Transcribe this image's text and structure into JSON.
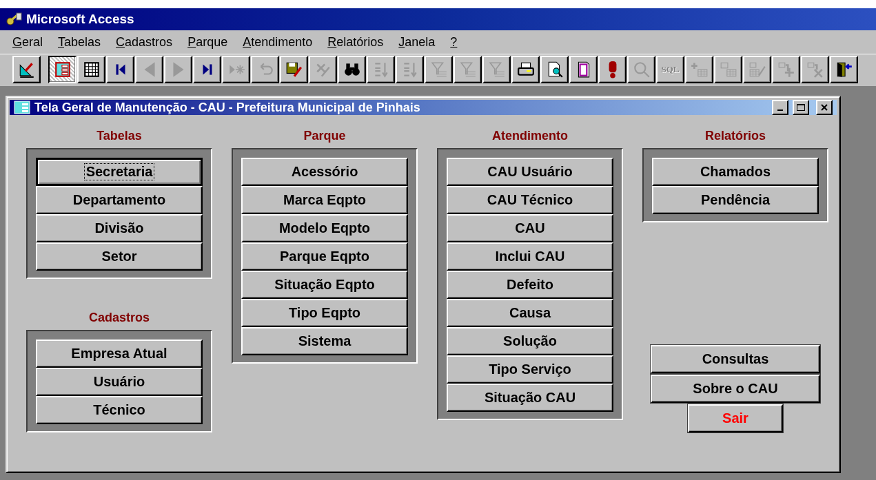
{
  "window": {
    "title": "Microsoft Access"
  },
  "menu": [
    "Geral",
    "Tabelas",
    "Cadastros",
    "Parque",
    "Atendimento",
    "Relatórios",
    "Janela",
    "?"
  ],
  "toolbar": [
    {
      "kind": "design",
      "disabled": false,
      "pressed": false
    },
    {
      "kind": "form",
      "disabled": false,
      "pressed": true
    },
    {
      "kind": "datasheet",
      "disabled": false,
      "pressed": false
    },
    {
      "kind": "first",
      "disabled": false,
      "pressed": false
    },
    {
      "kind": "prev",
      "disabled": true,
      "pressed": false
    },
    {
      "kind": "next",
      "disabled": true,
      "pressed": false
    },
    {
      "kind": "last",
      "disabled": false,
      "pressed": false
    },
    {
      "kind": "new-record",
      "disabled": true,
      "pressed": false
    },
    {
      "kind": "undo",
      "disabled": true,
      "pressed": false
    },
    {
      "kind": "save",
      "disabled": false,
      "pressed": false
    },
    {
      "kind": "delete",
      "disabled": true,
      "pressed": false
    },
    {
      "kind": "find",
      "disabled": false,
      "pressed": false
    },
    {
      "kind": "sort-asc",
      "disabled": true,
      "pressed": false
    },
    {
      "kind": "sort-desc",
      "disabled": true,
      "pressed": false
    },
    {
      "kind": "filter",
      "disabled": true,
      "pressed": false
    },
    {
      "kind": "filter",
      "disabled": true,
      "pressed": false
    },
    {
      "kind": "filter",
      "disabled": true,
      "pressed": false
    },
    {
      "kind": "print",
      "disabled": false,
      "pressed": false
    },
    {
      "kind": "preview",
      "disabled": false,
      "pressed": false
    },
    {
      "kind": "page",
      "disabled": false,
      "pressed": false
    },
    {
      "kind": "run",
      "disabled": false,
      "pressed": false
    },
    {
      "kind": "zoom",
      "disabled": true,
      "pressed": false
    },
    {
      "kind": "sql",
      "label": "SQL",
      "disabled": true,
      "pressed": false
    },
    {
      "kind": "table-add",
      "disabled": true,
      "pressed": false
    },
    {
      "kind": "table-show",
      "disabled": true,
      "pressed": false
    },
    {
      "kind": "table-edit",
      "disabled": true,
      "pressed": false
    },
    {
      "kind": "relation-add",
      "disabled": true,
      "pressed": false
    },
    {
      "kind": "relation-remove",
      "disabled": true,
      "pressed": false
    },
    {
      "kind": "exit",
      "disabled": false,
      "pressed": false
    }
  ],
  "form": {
    "title": "Tela Geral de Manutenção - CAU - Prefeitura Municipal de Pinhais",
    "columns": [
      {
        "groups": [
          {
            "heading": "Tabelas",
            "buttons": [
              {
                "label": "Secretaria",
                "focused": true
              },
              {
                "label": "Departamento",
                "focused": false
              },
              {
                "label": "Divisão",
                "focused": false
              },
              {
                "label": "Setor",
                "focused": false
              }
            ]
          },
          {
            "heading": "Cadastros",
            "buttons": [
              {
                "label": "Empresa Atual",
                "focused": false
              },
              {
                "label": "Usuário",
                "focused": false
              },
              {
                "label": "Técnico",
                "focused": false
              }
            ]
          }
        ]
      },
      {
        "groups": [
          {
            "heading": "Parque",
            "buttons": [
              {
                "label": "Acessório",
                "focused": false
              },
              {
                "label": "Marca Eqpto",
                "focused": false
              },
              {
                "label": "Modelo Eqpto",
                "focused": false
              },
              {
                "label": "Parque Eqpto",
                "focused": false
              },
              {
                "label": "Situação Eqpto",
                "focused": false
              },
              {
                "label": "Tipo Eqpto",
                "focused": false
              },
              {
                "label": "Sistema",
                "focused": false
              }
            ]
          }
        ]
      },
      {
        "groups": [
          {
            "heading": "Atendimento",
            "buttons": [
              {
                "label": "CAU Usuário",
                "focused": false
              },
              {
                "label": "CAU Técnico",
                "focused": false
              },
              {
                "label": "CAU",
                "focused": false
              },
              {
                "label": "Inclui CAU",
                "focused": false
              },
              {
                "label": "Defeito",
                "focused": false
              },
              {
                "label": "Causa",
                "focused": false
              },
              {
                "label": "Solução",
                "focused": false
              },
              {
                "label": "Tipo Serviço",
                "focused": false
              },
              {
                "label": "Situação CAU",
                "focused": false
              }
            ]
          }
        ]
      },
      {
        "groups": [
          {
            "heading": "Relatórios",
            "buttons": [
              {
                "label": "Chamados",
                "focused": false
              },
              {
                "label": "Pendência",
                "focused": false
              }
            ]
          }
        ],
        "actions": [
          {
            "label": "Consultas",
            "kind": "normal"
          },
          {
            "label": "Sobre o CAU",
            "kind": "normal"
          },
          {
            "label": "Sair",
            "kind": "exit"
          }
        ]
      }
    ]
  }
}
